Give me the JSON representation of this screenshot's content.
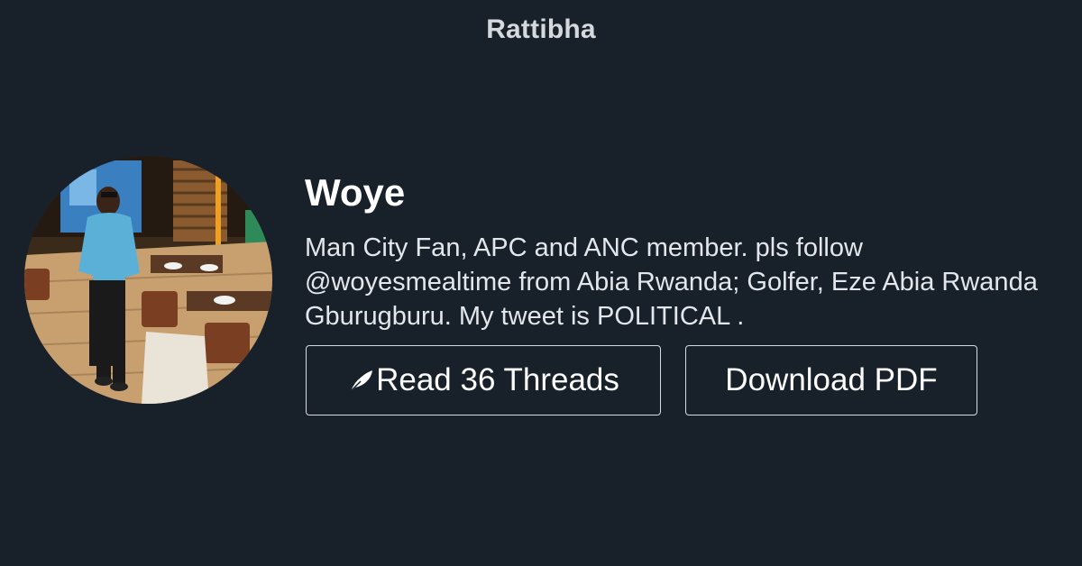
{
  "header": {
    "site_title": "Rattibha"
  },
  "profile": {
    "name": "Woye",
    "bio": "Man City Fan, APC and ANC member. pls follow @woyesmealtime from Abia Rwanda; Golfer, Eze Abia Rwanda Gburugburu. My tweet is POLITICAL .",
    "avatar_description_icon": "profile-photo"
  },
  "actions": {
    "read_label": "Read 36 Threads",
    "read_icon": "feather-icon",
    "download_label": "Download PDF"
  }
}
